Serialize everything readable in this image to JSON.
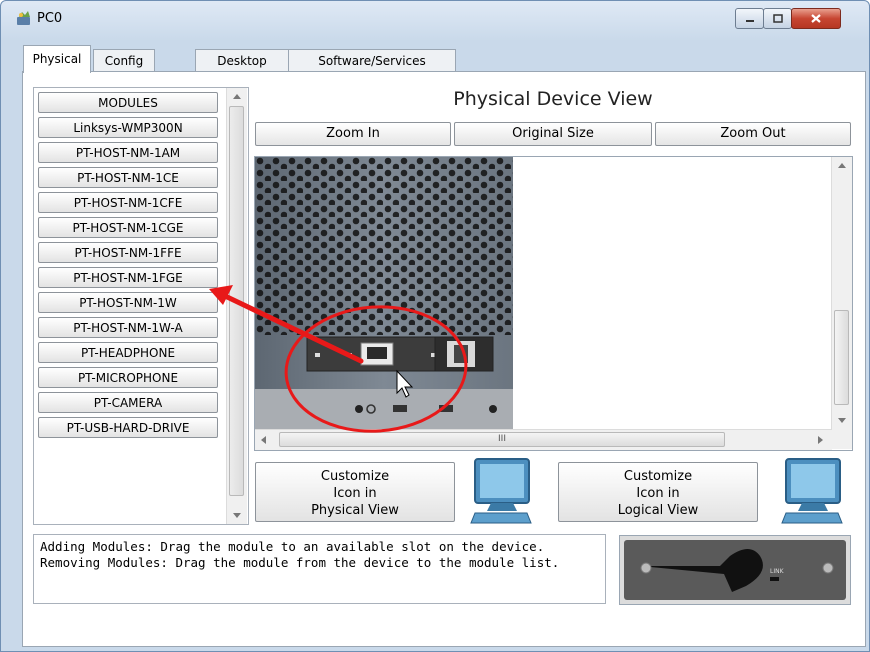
{
  "window": {
    "title": "PC0",
    "icon": "network-device-icon",
    "controls": [
      "minimize-icon",
      "maximize-icon",
      "close-icon"
    ]
  },
  "tabs": [
    {
      "label": "Physical",
      "active": true
    },
    {
      "label": "Config",
      "active": false
    },
    {
      "label": "Desktop",
      "active": false
    },
    {
      "label": "Software/Services",
      "active": false
    }
  ],
  "modules": {
    "items": [
      "MODULES",
      "Linksys-WMP300N",
      "PT-HOST-NM-1AM",
      "PT-HOST-NM-1CE",
      "PT-HOST-NM-1CFE",
      "PT-HOST-NM-1CGE",
      "PT-HOST-NM-1FFE",
      "PT-HOST-NM-1FGE",
      "PT-HOST-NM-1W",
      "PT-HOST-NM-1W-A",
      "PT-HEADPHONE",
      "PT-MICROPHONE",
      "PT-CAMERA",
      "PT-USB-HARD-DRIVE"
    ]
  },
  "physical_view": {
    "title": "Physical Device View",
    "zoom_in": "Zoom In",
    "original_size": "Original Size",
    "zoom_out": "Zoom Out",
    "hscroll_grip": "III"
  },
  "customize": {
    "physical": [
      "Customize",
      "Icon in",
      "Physical View"
    ],
    "logical": [
      "Customize",
      "Icon in",
      "Logical View"
    ]
  },
  "info": {
    "line1": "Adding Modules: Drag the module to an available slot on the device.",
    "line2": "Removing Modules: Drag the module from the device to the module list."
  },
  "module_preview": {
    "link_label": "LINK"
  },
  "colors": {
    "annotation": "#e81919",
    "window_frame": "#c9d9ea",
    "close_button": "#c74632"
  }
}
